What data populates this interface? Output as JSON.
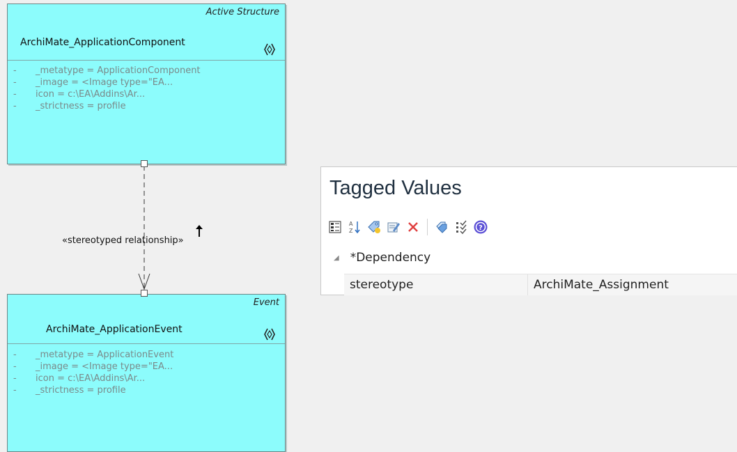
{
  "diagram": {
    "source_element": {
      "kind": "Active Structure",
      "name": "ArchiMate_ApplicationComponent",
      "attributes": [
        {
          "bullet": "-",
          "text": "_metatype = ApplicationComponent"
        },
        {
          "bullet": "-",
          "text": "_image = <Image type=\"EA..."
        },
        {
          "bullet": "-",
          "text": "icon = c:\\EA\\Addins\\Ar..."
        },
        {
          "bullet": "-",
          "text": "_strictness = profile"
        }
      ]
    },
    "target_element": {
      "kind": "Event",
      "name": "ArchiMate_ApplicationEvent",
      "attributes": [
        {
          "bullet": "-",
          "text": "_metatype = ApplicationEvent"
        },
        {
          "bullet": "-",
          "text": "_image = <Image type=\"EA..."
        },
        {
          "bullet": "-",
          "text": "icon = c:\\EA\\Addins\\Ar..."
        },
        {
          "bullet": "-",
          "text": "_strictness = profile"
        }
      ]
    },
    "relationship": {
      "label": "«stereotyped relationship»"
    }
  },
  "tagged_values": {
    "title": "Tagged Values",
    "toolbar": [
      {
        "icon": "categorized-view-icon"
      },
      {
        "icon": "sort-alphabetical-icon"
      },
      {
        "icon": "add-tag-icon"
      },
      {
        "icon": "edit-notes-icon"
      },
      {
        "icon": "delete-icon"
      },
      {
        "icon": "tag-groups-icon"
      },
      {
        "icon": "inherited-tags-icon"
      },
      {
        "icon": "help-icon"
      }
    ],
    "group": "*Dependency",
    "rows": [
      {
        "name": "stereotype",
        "value": "ArchiMate_Assignment"
      }
    ]
  },
  "colors": {
    "element_fill": "#8cfcfc",
    "background": "#f0f0f0"
  }
}
